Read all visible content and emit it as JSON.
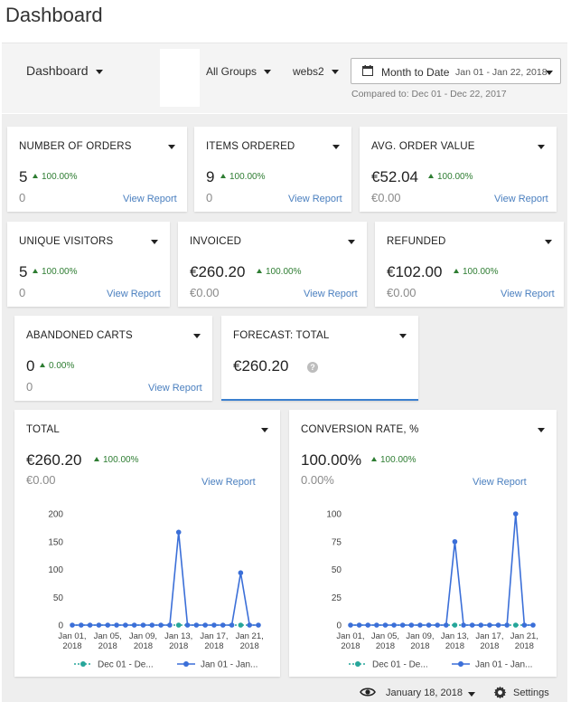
{
  "page_title": "Dashboard",
  "toolbar": {
    "dashboard_label": "Dashboard",
    "group_label": "All Groups",
    "store_label": "webs2",
    "date_label": "Month to Date",
    "date_range": "Jan 01 - Jan 22, 2018",
    "compared_text": "Compared to: Dec 01 - Dec 22, 2017"
  },
  "cards": {
    "orders": {
      "title": "NUMBER OF ORDERS",
      "value": "5",
      "delta": "100.00%",
      "prev": "0",
      "report": "View Report"
    },
    "items": {
      "title": "ITEMS ORDERED",
      "value": "9",
      "delta": "100.00%",
      "prev": "0",
      "report": "View Report"
    },
    "aov": {
      "title": "AVG. ORDER VALUE",
      "value": "€52.04",
      "delta": "100.00%",
      "prev": "€0.00",
      "report": "View Report"
    },
    "visitors": {
      "title": "UNIQUE VISITORS",
      "value": "5",
      "delta": "100.00%",
      "prev": "0",
      "report": "View Report"
    },
    "invoiced": {
      "title": "INVOICED",
      "value": "€260.20",
      "delta": "100.00%",
      "prev": "€0.00",
      "report": "View Report"
    },
    "refunded": {
      "title": "REFUNDED",
      "value": "€102.00",
      "delta": "100.00%",
      "prev": "€0.00",
      "report": "View Report"
    },
    "abandoned": {
      "title": "ABANDONED CARTS",
      "value": "0",
      "delta": "0.00%",
      "prev": "0",
      "report": "View Report"
    },
    "forecast": {
      "title": "FORECAST: TOTAL",
      "value": "€260.20"
    },
    "total": {
      "title": "TOTAL",
      "value": "€260.20",
      "delta": "100.00%",
      "prev": "€0.00",
      "report": "View Report"
    },
    "conversion": {
      "title": "CONVERSION RATE, %",
      "value": "100.00%",
      "delta": "100.00%",
      "prev": "0.00%",
      "report": "View Report"
    }
  },
  "chart_data": [
    {
      "type": "line",
      "title": "TOTAL",
      "x_tick_labels": [
        [
          "Jan 01,",
          "2018"
        ],
        [
          "Jan 05,",
          "2018"
        ],
        [
          "Jan 09,",
          "2018"
        ],
        [
          "Jan 13,",
          "2018"
        ],
        [
          "Jan 17,",
          "2018"
        ],
        [
          "Jan 21,",
          "2018"
        ]
      ],
      "x_tick_days": [
        1,
        5,
        9,
        13,
        17,
        21
      ],
      "x_days": [
        1,
        2,
        3,
        4,
        5,
        6,
        7,
        8,
        9,
        10,
        11,
        12,
        13,
        14,
        15,
        16,
        17,
        18,
        19,
        20,
        21,
        22
      ],
      "y_ticks": [
        0,
        50,
        100,
        150,
        200
      ],
      "ylim": [
        0,
        200
      ],
      "series": [
        {
          "name": "Dec 01 - De...",
          "color": "#26a69a",
          "dashed": true,
          "values": [
            0,
            0,
            0,
            0,
            0,
            0,
            0,
            0,
            0,
            0,
            0,
            0,
            0,
            0,
            0,
            0,
            0,
            0,
            0,
            0,
            0,
            0
          ]
        },
        {
          "name": "Jan 01 - Jan...",
          "color": "#3b6fd8",
          "dashed": false,
          "values": [
            0,
            0,
            0,
            0,
            0,
            0,
            0,
            0,
            0,
            0,
            0,
            0,
            167,
            0,
            0,
            0,
            0,
            0,
            0,
            94,
            0,
            0
          ]
        }
      ]
    },
    {
      "type": "line",
      "title": "CONVERSION RATE, %",
      "x_tick_labels": [
        [
          "Jan 01,",
          "2018"
        ],
        [
          "Jan 05,",
          "2018"
        ],
        [
          "Jan 09,",
          "2018"
        ],
        [
          "Jan 13,",
          "2018"
        ],
        [
          "Jan 17,",
          "2018"
        ],
        [
          "Jan 21,",
          "2018"
        ]
      ],
      "x_tick_days": [
        1,
        5,
        9,
        13,
        17,
        21
      ],
      "x_days": [
        1,
        2,
        3,
        4,
        5,
        6,
        7,
        8,
        9,
        10,
        11,
        12,
        13,
        14,
        15,
        16,
        17,
        18,
        19,
        20,
        21,
        22
      ],
      "y_ticks": [
        0,
        25,
        50,
        75,
        100
      ],
      "ylim": [
        0,
        100
      ],
      "series": [
        {
          "name": "Dec 01 - De...",
          "color": "#26a69a",
          "dashed": true,
          "values": [
            0,
            0,
            0,
            0,
            0,
            0,
            0,
            0,
            0,
            0,
            0,
            0,
            0,
            0,
            0,
            0,
            0,
            0,
            0,
            0,
            0,
            0
          ]
        },
        {
          "name": "Jan 01 - Jan...",
          "color": "#3b6fd8",
          "dashed": false,
          "values": [
            0,
            0,
            0,
            0,
            0,
            0,
            0,
            0,
            0,
            0,
            0,
            0,
            75,
            0,
            0,
            0,
            0,
            0,
            0,
            100,
            0,
            0
          ]
        }
      ]
    }
  ],
  "footer": {
    "date_label": "January 18, 2018",
    "settings_label": "Settings"
  }
}
